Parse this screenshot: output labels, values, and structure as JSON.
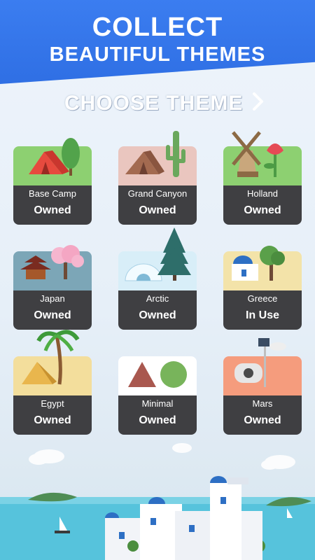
{
  "banner": {
    "line1": "COLLECT",
    "line2": "BEAUTIFUL THEMES"
  },
  "choose": {
    "label": "CHOOSE THEME",
    "arrow": "chevron-right-icon"
  },
  "themes": [
    {
      "name": "Base Camp",
      "status": "Owned",
      "bg": "#8dd071"
    },
    {
      "name": "Grand Canyon",
      "status": "Owned",
      "bg": "#eac6bf"
    },
    {
      "name": "Holland",
      "status": "Owned",
      "bg": "#8dd071"
    },
    {
      "name": "Japan",
      "status": "Owned",
      "bg": "#7ca6b7"
    },
    {
      "name": "Arctic",
      "status": "Owned",
      "bg": "#d8eef8"
    },
    {
      "name": "Greece",
      "status": "In Use",
      "bg": "#f3e3a9"
    },
    {
      "name": "Egypt",
      "status": "Owned",
      "bg": "#f3de9c"
    },
    {
      "name": "Minimal",
      "status": "Owned",
      "bg": "#ffffff"
    },
    {
      "name": "Mars",
      "status": "Owned",
      "bg": "#f59c7d"
    }
  ],
  "colors": {
    "banner": "#3479ed",
    "card_bottom": "#3f3f42"
  }
}
